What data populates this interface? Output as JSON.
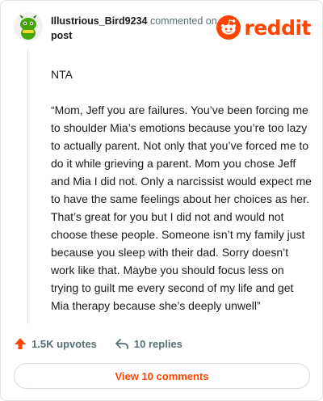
{
  "comment": {
    "username": "Illustrious_Bird9234",
    "action_text": "commented on",
    "target_text": "post",
    "avatar_icon": "snoo-avatar-icon",
    "paragraphs": [
      "NTA",
      "“Mom, Jeff you are failures. You’ve been forcing me to shoulder Mia’s emotions because you’re too lazy to actually parent. Not only that you’ve forced me to do it while grieving a parent. Mom you chose Jeff and Mia I did not. Only a narcissist would expect me to have the same feelings about her choices as her. That’s great for you but I did not and would not choose these people. Someone isn’t my family just because you sleep with their dad. Sorry doesn’t work like that. Maybe you should focus less on trying to guilt me every second of my life and get Mia therapy because she’s deeply unwell”"
    ]
  },
  "brand": {
    "wordmark": "reddit",
    "logo_icon": "reddit-snoo-icon",
    "color": "#ff4500"
  },
  "actions": {
    "upvotes_label": "1.5K upvotes",
    "upvote_icon": "upvote-arrow-icon",
    "replies_label": "10 replies",
    "reply_icon": "reply-arrow-icon"
  },
  "footer": {
    "view_comments_label": "View 10 comments"
  }
}
